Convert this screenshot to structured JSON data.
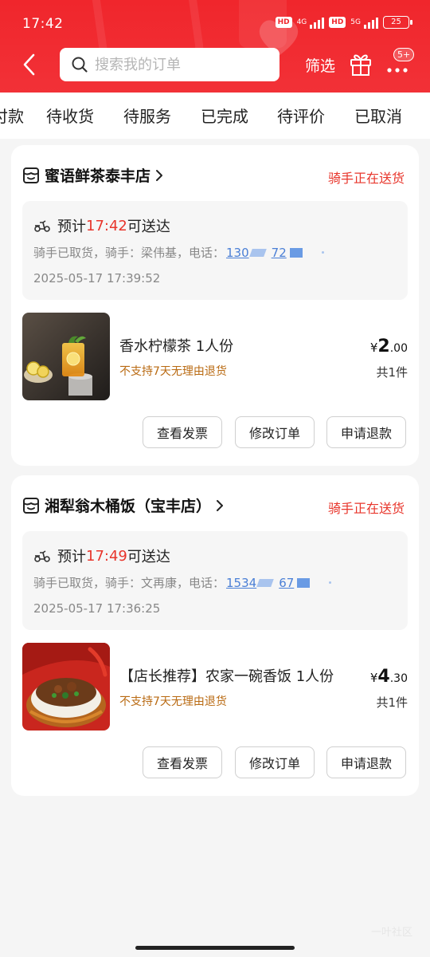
{
  "status_bar": {
    "time": "17:42",
    "net1": "4G",
    "net2": "5G",
    "hd": "HD",
    "battery": "25"
  },
  "header": {
    "search_placeholder": "搜索我的订单",
    "filter_label": "筛选",
    "more_badge": "5+",
    "colors": {
      "brand": "#f0262c",
      "accent_red": "#e8352b",
      "link_blue": "#4a7fd6",
      "warning_orange": "#b96a12"
    },
    "icons": [
      "back-arrow-icon",
      "search-icon",
      "gift-icon",
      "more-dots-icon"
    ]
  },
  "tabs": [
    "付款",
    "待收货",
    "待服务",
    "已完成",
    "待评价",
    "已取消"
  ],
  "orders": [
    {
      "shop_name": "蜜语鲜茶泰丰店",
      "status": "骑手正在送货",
      "eta_prefix": "预计",
      "eta_time": "17:42",
      "eta_suffix": "可送达",
      "rider_text": "骑手已取货，骑手：梁伟基，电话：",
      "phone_part1": "130",
      "phone_part2": "72",
      "order_time": "2025-05-17 17:39:52",
      "product_name": "香水柠檬茶 1人份",
      "product_note": "不支持7天无理由退货",
      "price_symbol": "¥",
      "price_int": "2",
      "price_dec": ".00",
      "quantity": "共1件",
      "buttons": [
        "查看发票",
        "修改订单",
        "申请退款"
      ]
    },
    {
      "shop_name": "湘犁翁木桶饭（宝丰店）",
      "status": "骑手正在送货",
      "eta_prefix": "预计",
      "eta_time": "17:49",
      "eta_suffix": "可送达",
      "rider_text": "骑手已取货，骑手：文再康，电话：",
      "phone_part1": "1534",
      "phone_part2": "67",
      "order_time": "2025-05-17 17:36:25",
      "product_name": "【店长推荐】农家一碗香饭 1人份",
      "product_note": "不支持7天无理由退货",
      "price_symbol": "¥",
      "price_int": "4",
      "price_dec": ".30",
      "quantity": "共1件",
      "buttons": [
        "查看发票",
        "修改订单",
        "申请退款"
      ]
    }
  ],
  "watermark": "一叶社区"
}
